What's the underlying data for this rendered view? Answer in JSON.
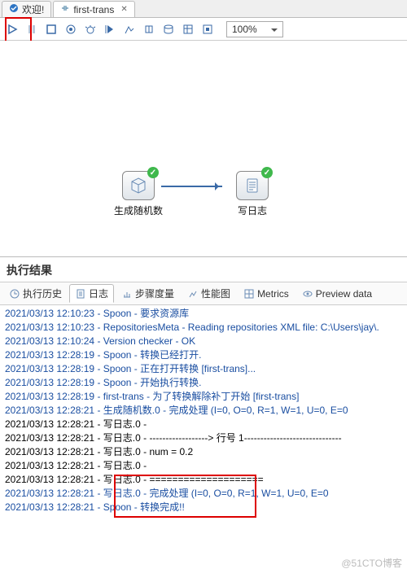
{
  "tabs": {
    "welcome": "欢迎!",
    "trans": "first-trans"
  },
  "toolbar": {
    "zoom": "100%"
  },
  "nodes": {
    "gen": "生成随机数",
    "log": "写日志"
  },
  "results": {
    "title": "执行结果",
    "tabs": {
      "history": "执行历史",
      "log": "日志",
      "step": "步骤度量",
      "perf": "性能图",
      "metrics": "Metrics",
      "preview": "Preview data"
    }
  },
  "log": [
    {
      "c": "blue",
      "t": "2021/03/13 12:10:23 - Spoon - 要求资源库"
    },
    {
      "c": "blue",
      "t": "2021/03/13 12:10:23 - RepositoriesMeta - Reading repositories XML file: C:\\Users\\jay\\."
    },
    {
      "c": "blue",
      "t": "2021/03/13 12:10:24 - Version checker - OK"
    },
    {
      "c": "blue",
      "t": "2021/03/13 12:28:19 - Spoon - 转换已经打开."
    },
    {
      "c": "blue",
      "t": "2021/03/13 12:28:19 - Spoon - 正在打开转换 [first-trans]..."
    },
    {
      "c": "blue",
      "t": "2021/03/13 12:28:19 - Spoon - 开始执行转换."
    },
    {
      "c": "blue",
      "t": "2021/03/13 12:28:19 - first-trans - 为了转换解除补丁开始  [first-trans]"
    },
    {
      "c": "blue",
      "t": "2021/03/13 12:28:21 - 生成随机数.0 - 完成处理 (I=0, O=0, R=1, W=1, U=0, E=0"
    },
    {
      "c": "black",
      "t": "2021/03/13 12:28:21 - 写日志.0 - "
    },
    {
      "c": "black",
      "t": "2021/03/13 12:28:21 - 写日志.0 - ------------------> 行号 1------------------------------"
    },
    {
      "c": "black",
      "t": "2021/03/13 12:28:21 - 写日志.0 - num = 0.2"
    },
    {
      "c": "black",
      "t": "2021/03/13 12:28:21 - 写日志.0 - "
    },
    {
      "c": "black",
      "t": "2021/03/13 12:28:21 - 写日志.0 - ===================="
    },
    {
      "c": "blue",
      "t": "2021/03/13 12:28:21 - 写日志.0 - 完成处理 (I=0, O=0, R=1, W=1, U=0, E=0"
    },
    {
      "c": "blue",
      "t": "2021/03/13 12:28:21 - Spoon - 转换完成!!"
    }
  ],
  "watermark": "@51CTO博客"
}
